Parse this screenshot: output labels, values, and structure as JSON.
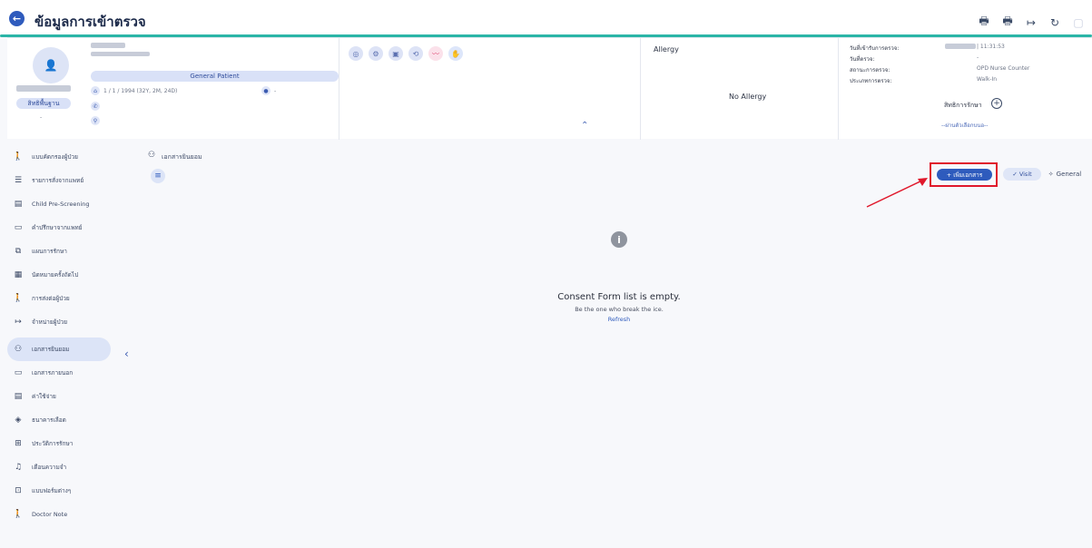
{
  "header": {
    "title": "ข้อมูลการเข้าตรวจ",
    "back_icon": "arrow-left-icon",
    "icons": [
      "print-icon",
      "print-alt-icon",
      "logout-icon",
      "refresh-icon",
      "expand-icon"
    ],
    "accent": "#2bb5a7",
    "brand": "#2f5bbd"
  },
  "patient": {
    "category": "General Patient",
    "birth": "1 / 1 / 1994 (32Y, 2M, 24D)",
    "blood_value": "-",
    "rights_badge": "สิทธิพื้นฐาน",
    "rights_sub": "-"
  },
  "allergy": {
    "title": "Allergy",
    "status": "No Allergy"
  },
  "visit_info": {
    "rows": [
      {
        "label": "วันที่เข้ารับการตรวจ:",
        "value": "| 11:31:53"
      },
      {
        "label": "วันที่ตรวจ:",
        "value": "-"
      },
      {
        "label": "สถานะการตรวจ:",
        "value": "OPD Nurse Counter"
      },
      {
        "label": "ประเภทการตรวจ:",
        "value": "Walk-In"
      }
    ],
    "rights_label": "สิทธิการรักษา",
    "rights_placeholder": "--ผ่านตัวเลือกบนอ--"
  },
  "sidebar": {
    "items": [
      {
        "label": "แบบคัดกรองผู้ป่วย",
        "icon": "person-check-icon"
      },
      {
        "label": "รายการสั่งจากแพทย์",
        "icon": "list-icon"
      },
      {
        "label": "Child Pre-Screening",
        "icon": "clipboard-icon"
      },
      {
        "label": "คำปรึกษาจากแพทย์",
        "icon": "chat-icon"
      },
      {
        "label": "แผนการรักษา",
        "icon": "flow-icon"
      },
      {
        "label": "นัดหมายครั้งถัดไป",
        "icon": "calendar-icon"
      },
      {
        "label": "การส่งต่อผู้ป่วย",
        "icon": "transfer-icon"
      },
      {
        "label": "จำหน่ายผู้ป่วย",
        "icon": "discharge-icon"
      },
      {
        "label": "เอกสารยินยอม",
        "icon": "consent-icon",
        "active": true
      },
      {
        "label": "เอกสารภายนอก",
        "icon": "folder-icon"
      },
      {
        "label": "ค่าใช้จ่าย",
        "icon": "receipt-icon"
      },
      {
        "label": "ธนาคารเลือด",
        "icon": "blood-icon"
      },
      {
        "label": "ประวัติการรักษา",
        "icon": "history-icon"
      },
      {
        "label": "เตือนความจำ",
        "icon": "bell-icon"
      },
      {
        "label": "แบบฟอร์มต่างๆ",
        "icon": "form-icon"
      },
      {
        "label": "Doctor Note",
        "icon": "doctor-note-icon"
      }
    ]
  },
  "main": {
    "title": "เอกสารยินยอม",
    "add_label": "+ เพิ่มเอกสาร",
    "visit_label": "✓ Visit",
    "general_label": "General",
    "empty_title": "Consent Form list is empty.",
    "empty_sub": "Be the one who break the ice.",
    "refresh_label": "Refresh"
  }
}
